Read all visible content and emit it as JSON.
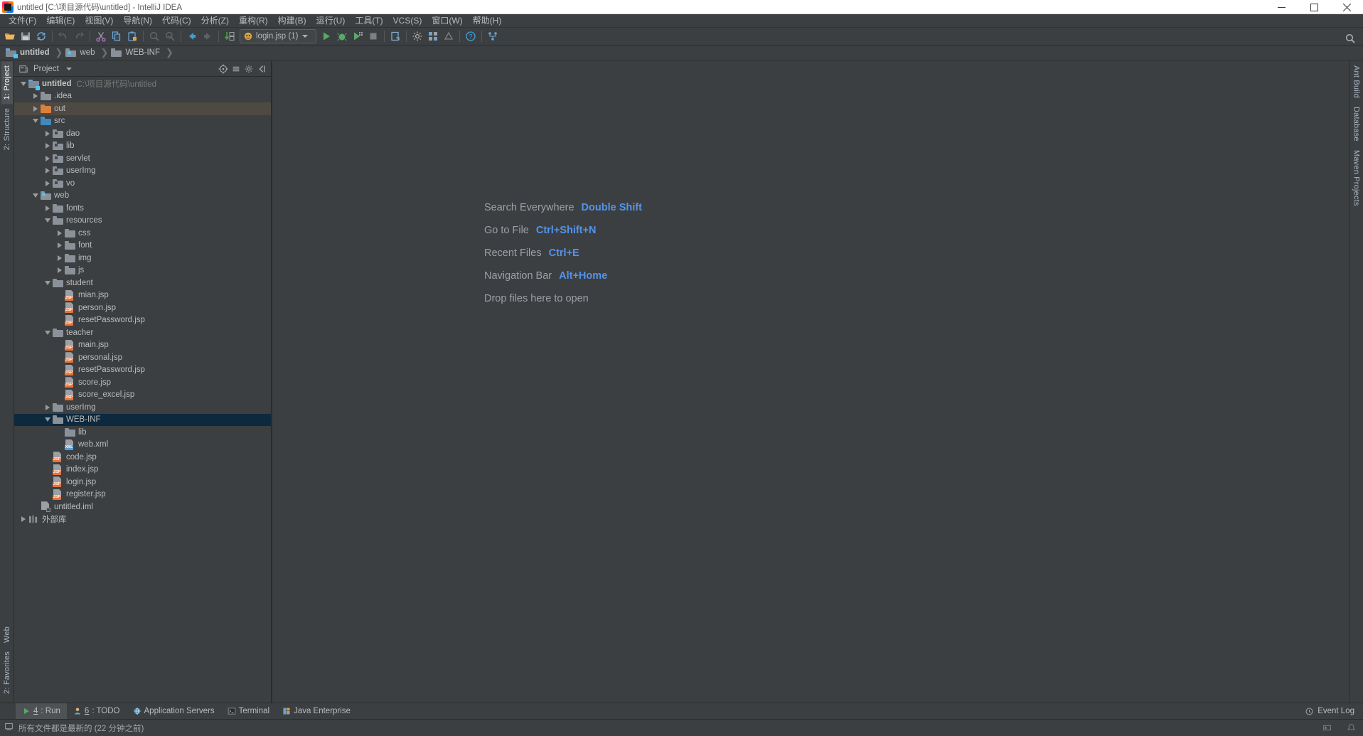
{
  "window": {
    "title": "untitled [C:\\项目源代码\\untitled] - IntelliJ IDEA",
    "minimize_label": "Minimize",
    "maximize_label": "Maximize",
    "close_label": "Close"
  },
  "menubar": {
    "items": [
      {
        "label": "文件(F)"
      },
      {
        "label": "编辑(E)"
      },
      {
        "label": "视图(V)"
      },
      {
        "label": "导航(N)"
      },
      {
        "label": "代码(C)"
      },
      {
        "label": "分析(Z)"
      },
      {
        "label": "重构(R)"
      },
      {
        "label": "构建(B)"
      },
      {
        "label": "运行(U)"
      },
      {
        "label": "工具(T)"
      },
      {
        "label": "VCS(S)"
      },
      {
        "label": "窗口(W)"
      },
      {
        "label": "帮助(H)"
      }
    ]
  },
  "toolbar": {
    "open_label": "Open",
    "save_label": "Save All",
    "sync_label": "Synchronize",
    "undo_label": "Undo",
    "redo_label": "Redo",
    "cut_label": "Cut",
    "copy_label": "Copy",
    "paste_label": "Paste",
    "find_label": "Find",
    "replace_label": "Replace",
    "back_label": "Back",
    "forward_label": "Forward",
    "compile_label": "Compile",
    "run_config_name": "login.jsp (1)",
    "run_label": "Run",
    "debug_label": "Debug",
    "run_coverage_label": "Run with Coverage",
    "stop_label": "Stop",
    "update_app_label": "Update Application",
    "settings_label": "Settings",
    "project_structure_label": "Project Structure",
    "help_label": "Help",
    "vcs_label": "VCS Operations",
    "search_everywhere_label": "Search Everywhere"
  },
  "navbar": {
    "crumbs": [
      {
        "label": "untitled",
        "icon": "module-icon",
        "bold": true
      },
      {
        "label": "web",
        "icon": "web-folder-icon",
        "bold": false
      },
      {
        "label": "WEB-INF",
        "icon": "folder-icon",
        "bold": false
      }
    ]
  },
  "left_strip": {
    "tabs": [
      {
        "label": "1: Project",
        "active": true
      },
      {
        "label": "2: Structure",
        "active": false
      }
    ],
    "bottom_tabs": [
      {
        "label": "Web"
      },
      {
        "label": "2: Favorites"
      }
    ]
  },
  "right_strip": {
    "tabs": [
      {
        "label": "Ant Build"
      },
      {
        "label": "Database"
      },
      {
        "label": "Maven Projects"
      }
    ]
  },
  "project_panel": {
    "title": "Project",
    "locate_icon_label": "Scroll from Source",
    "collapse_icon_label": "Collapse All",
    "settings_icon_label": "Settings",
    "hide_icon_label": "Hide",
    "tree": [
      {
        "label": "untitled",
        "sub": "C:\\项目源代码\\untitled",
        "indent": 0,
        "twist": "open",
        "icon": "module-icon",
        "bold": true,
        "state": ""
      },
      {
        "label": ".idea",
        "sub": "",
        "indent": 1,
        "twist": "closed",
        "icon": "folder-icon",
        "bold": false,
        "state": ""
      },
      {
        "label": "out",
        "sub": "",
        "indent": 1,
        "twist": "closed",
        "icon": "folder-excluded-icon",
        "bold": false,
        "state": "hl"
      },
      {
        "label": "src",
        "sub": "",
        "indent": 1,
        "twist": "open",
        "icon": "folder-source-icon",
        "bold": false,
        "state": ""
      },
      {
        "label": "dao",
        "sub": "",
        "indent": 2,
        "twist": "closed",
        "icon": "package-icon",
        "bold": false,
        "state": ""
      },
      {
        "label": "lib",
        "sub": "",
        "indent": 2,
        "twist": "closed",
        "icon": "package-icon",
        "bold": false,
        "state": ""
      },
      {
        "label": "servlet",
        "sub": "",
        "indent": 2,
        "twist": "closed",
        "icon": "package-icon",
        "bold": false,
        "state": ""
      },
      {
        "label": "userImg",
        "sub": "",
        "indent": 2,
        "twist": "closed",
        "icon": "package-icon",
        "bold": false,
        "state": ""
      },
      {
        "label": "vo",
        "sub": "",
        "indent": 2,
        "twist": "closed",
        "icon": "package-icon",
        "bold": false,
        "state": ""
      },
      {
        "label": "web",
        "sub": "",
        "indent": 1,
        "twist": "open",
        "icon": "web-folder-icon",
        "bold": false,
        "state": ""
      },
      {
        "label": "fonts",
        "sub": "",
        "indent": 2,
        "twist": "closed",
        "icon": "folder-icon",
        "bold": false,
        "state": ""
      },
      {
        "label": "resources",
        "sub": "",
        "indent": 2,
        "twist": "open",
        "icon": "folder-icon",
        "bold": false,
        "state": ""
      },
      {
        "label": "css",
        "sub": "",
        "indent": 3,
        "twist": "closed",
        "icon": "folder-icon",
        "bold": false,
        "state": ""
      },
      {
        "label": "font",
        "sub": "",
        "indent": 3,
        "twist": "closed",
        "icon": "folder-icon",
        "bold": false,
        "state": ""
      },
      {
        "label": "img",
        "sub": "",
        "indent": 3,
        "twist": "closed",
        "icon": "folder-icon",
        "bold": false,
        "state": ""
      },
      {
        "label": "js",
        "sub": "",
        "indent": 3,
        "twist": "closed",
        "icon": "folder-icon",
        "bold": false,
        "state": ""
      },
      {
        "label": "student",
        "sub": "",
        "indent": 2,
        "twist": "open",
        "icon": "folder-icon",
        "bold": false,
        "state": ""
      },
      {
        "label": "mian.jsp",
        "sub": "",
        "indent": 3,
        "twist": "none",
        "icon": "jsp-icon",
        "bold": false,
        "state": ""
      },
      {
        "label": "person.jsp",
        "sub": "",
        "indent": 3,
        "twist": "none",
        "icon": "jsp-icon",
        "bold": false,
        "state": ""
      },
      {
        "label": "resetPassword.jsp",
        "sub": "",
        "indent": 3,
        "twist": "none",
        "icon": "jsp-icon",
        "bold": false,
        "state": ""
      },
      {
        "label": "teacher",
        "sub": "",
        "indent": 2,
        "twist": "open",
        "icon": "folder-icon",
        "bold": false,
        "state": ""
      },
      {
        "label": "main.jsp",
        "sub": "",
        "indent": 3,
        "twist": "none",
        "icon": "jsp-icon",
        "bold": false,
        "state": ""
      },
      {
        "label": "personal.jsp",
        "sub": "",
        "indent": 3,
        "twist": "none",
        "icon": "jsp-icon",
        "bold": false,
        "state": ""
      },
      {
        "label": "resetPassword.jsp",
        "sub": "",
        "indent": 3,
        "twist": "none",
        "icon": "jsp-icon",
        "bold": false,
        "state": ""
      },
      {
        "label": "score.jsp",
        "sub": "",
        "indent": 3,
        "twist": "none",
        "icon": "jsp-icon",
        "bold": false,
        "state": ""
      },
      {
        "label": "score_excel.jsp",
        "sub": "",
        "indent": 3,
        "twist": "none",
        "icon": "jsp-icon",
        "bold": false,
        "state": ""
      },
      {
        "label": "userImg",
        "sub": "",
        "indent": 2,
        "twist": "closed",
        "icon": "folder-icon",
        "bold": false,
        "state": ""
      },
      {
        "label": "WEB-INF",
        "sub": "",
        "indent": 2,
        "twist": "open",
        "icon": "folder-icon",
        "bold": false,
        "state": "sel"
      },
      {
        "label": "lib",
        "sub": "",
        "indent": 3,
        "twist": "none",
        "icon": "folder-icon",
        "bold": false,
        "state": ""
      },
      {
        "label": "web.xml",
        "sub": "",
        "indent": 3,
        "twist": "none",
        "icon": "xml-icon",
        "bold": false,
        "state": ""
      },
      {
        "label": "code.jsp",
        "sub": "",
        "indent": 2,
        "twist": "none",
        "icon": "jsp-icon",
        "bold": false,
        "state": ""
      },
      {
        "label": "index.jsp",
        "sub": "",
        "indent": 2,
        "twist": "none",
        "icon": "jsp-icon",
        "bold": false,
        "state": ""
      },
      {
        "label": "login.jsp",
        "sub": "",
        "indent": 2,
        "twist": "none",
        "icon": "jsp-icon",
        "bold": false,
        "state": ""
      },
      {
        "label": "register.jsp",
        "sub": "",
        "indent": 2,
        "twist": "none",
        "icon": "jsp-icon",
        "bold": false,
        "state": ""
      },
      {
        "label": "untitled.iml",
        "sub": "",
        "indent": 1,
        "twist": "none",
        "icon": "iml-icon",
        "bold": false,
        "state": ""
      },
      {
        "label": "外部库",
        "sub": "",
        "indent": 0,
        "twist": "closed",
        "icon": "library-icon",
        "bold": false,
        "state": ""
      }
    ]
  },
  "editor": {
    "tips": [
      {
        "label": "Search Everywhere",
        "key": "Double Shift"
      },
      {
        "label": "Go to File",
        "key": "Ctrl+Shift+N"
      },
      {
        "label": "Recent Files",
        "key": "Ctrl+E"
      },
      {
        "label": "Navigation Bar",
        "key": "Alt+Home"
      },
      {
        "label": "Drop files here to open",
        "key": ""
      }
    ]
  },
  "bottom_bar": {
    "tabs": [
      {
        "num": "4",
        "label": ": Run",
        "icon": "run-icon",
        "active": true
      },
      {
        "num": "6",
        "label": ": TODO",
        "icon": "todo-icon",
        "active": false
      },
      {
        "num": "",
        "label": "Application Servers",
        "icon": "app-servers-icon",
        "active": false
      },
      {
        "num": "",
        "label": "Terminal",
        "icon": "terminal-icon",
        "active": false
      },
      {
        "num": "",
        "label": "Java Enterprise",
        "icon": "java-ee-icon",
        "active": false
      }
    ],
    "event_log_label": "Event Log"
  },
  "status_bar": {
    "message": "所有文件都是最新的 (22 分钟之前)"
  },
  "colors": {
    "accent_blue": "#5394ec",
    "selection": "#0d293e",
    "panel_bg": "#3c3f41",
    "folder_blue": "#5f9ac7",
    "folder_grey": "#8a9199",
    "folder_orange": "#cc7832",
    "jsp_badge": "#e8733a"
  }
}
